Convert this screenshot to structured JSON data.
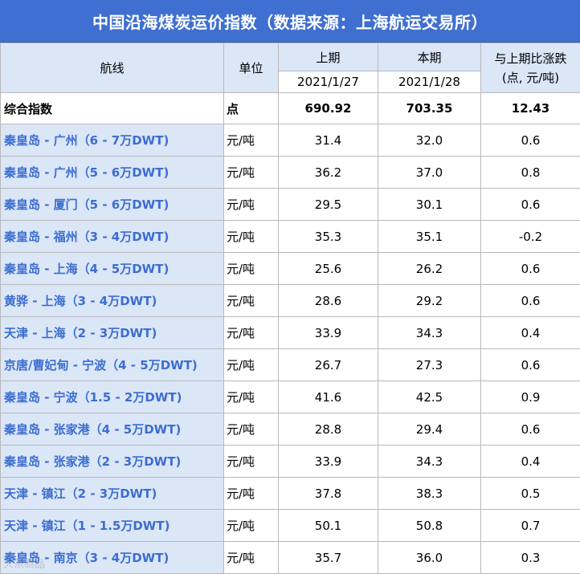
{
  "title": "中国沿海煤炭运价指数（数据来源：上海航运交易所）",
  "headers": {
    "route": "航线",
    "unit": "单位",
    "prev": "上期",
    "cur": "本期",
    "change": "与上期比涨跌",
    "change_unit": "(点, 元/吨)",
    "prev_date": "2021/1/27",
    "cur_date": "2021/1/28"
  },
  "summary": {
    "route": "综合指数",
    "unit": "点",
    "prev": "690.92",
    "cur": "703.35",
    "change": "12.43"
  },
  "rows": [
    {
      "route": "秦皇岛 - 广州（6 - 7万DWT)",
      "unit": "元/吨",
      "prev": "31.4",
      "cur": "32.0",
      "change": "0.6"
    },
    {
      "route": "秦皇岛 - 广州（5 - 6万DWT)",
      "unit": "元/吨",
      "prev": "36.2",
      "cur": "37.0",
      "change": "0.8"
    },
    {
      "route": "秦皇岛 - 厦门（5 - 6万DWT)",
      "unit": "元/吨",
      "prev": "29.5",
      "cur": "30.1",
      "change": "0.6"
    },
    {
      "route": "秦皇岛 - 福州（3 - 4万DWT)",
      "unit": "元/吨",
      "prev": "35.3",
      "cur": "35.1",
      "change": "-0.2"
    },
    {
      "route": "秦皇岛 - 上海（4 - 5万DWT)",
      "unit": "元/吨",
      "prev": "25.6",
      "cur": "26.2",
      "change": "0.6"
    },
    {
      "route": "黄骅 - 上海（3 - 4万DWT)",
      "unit": "元/吨",
      "prev": "28.6",
      "cur": "29.2",
      "change": "0.6"
    },
    {
      "route": "天津 - 上海（2 - 3万DWT)",
      "unit": "元/吨",
      "prev": "33.9",
      "cur": "34.3",
      "change": "0.4"
    },
    {
      "route": "京唐/曹妃甸 - 宁波（4 - 5万DWT)",
      "unit": "元/吨",
      "prev": "26.7",
      "cur": "27.3",
      "change": "0.6"
    },
    {
      "route": "秦皇岛 - 宁波（1.5 - 2万DWT)",
      "unit": "元/吨",
      "prev": "41.6",
      "cur": "42.5",
      "change": "0.9"
    },
    {
      "route": "秦皇岛 - 张家港（4 - 5万DWT)",
      "unit": "元/吨",
      "prev": "28.8",
      "cur": "29.4",
      "change": "0.6"
    },
    {
      "route": "秦皇岛 - 张家港（2 - 3万DWT)",
      "unit": "元/吨",
      "prev": "33.9",
      "cur": "34.3",
      "change": "0.4"
    },
    {
      "route": "天津 - 镇江（2 - 3万DWT)",
      "unit": "元/吨",
      "prev": "37.8",
      "cur": "38.3",
      "change": "0.5"
    },
    {
      "route": "天津 - 镇江（1 - 1.5万DWT)",
      "unit": "元/吨",
      "prev": "50.1",
      "cur": "50.8",
      "change": "0.7"
    },
    {
      "route": "秦皇岛 - 南京（3 - 4万DWT)",
      "unit": "元/吨",
      "prev": "35.7",
      "cur": "36.0",
      "change": "0.3"
    }
  ],
  "watermark": "大宗商品",
  "colors": {
    "title_bg": "#3f6fd0",
    "header_bg": "#dbe6f7",
    "route_text": "#3c6ed0"
  }
}
